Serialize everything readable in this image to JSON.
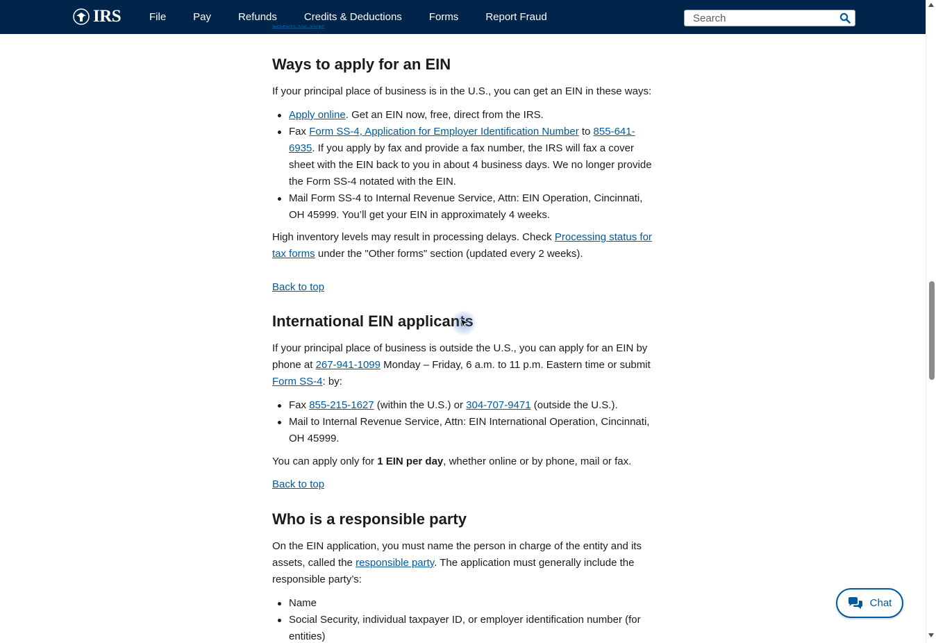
{
  "header": {
    "logo_text": "IRS",
    "nav": [
      "File",
      "Pay",
      "Refunds",
      "Credits & Deductions",
      "Forms",
      "Report Fraud"
    ],
    "search_placeholder": "Search"
  },
  "section_ways": {
    "heading": "Ways to apply for an EIN",
    "intro": "If your principal place of business is in the U.S., you can get an EIN in these ways:",
    "item1_link": "Apply online",
    "item1_text": ". Get an EIN now, free, direct from the IRS.",
    "item2_prefix": "Fax ",
    "item2_link_form": "Form SS-4, Application for Employer Identification Number",
    "item2_mid": " to ",
    "item2_link_phone": "855-641-6935",
    "item2_text": ". If you apply by fax and provide a fax number, the IRS will fax a cover sheet with the EIN back to you in about 4 business days. We no longer provide the Form SS-4 notated with the EIN.",
    "item3_text": "Mail Form SS-4 to Internal Revenue Service, Attn: EIN Operation, Cincinnati, OH 45999. You’ll get your EIN in approximately 4 weeks.",
    "delay_prefix": "High inventory levels may result in processing delays. Check ",
    "delay_link": "Processing status for tax forms",
    "delay_suffix": " under the \"Other forms\" section (updated every 2 weeks).",
    "back_to_top": "Back to top"
  },
  "section_international": {
    "heading": "International EIN applicants",
    "intro_prefix": "If your principal place of business is outside the U.S., you can apply for an EIN by phone at ",
    "phone_link": "267-941-1099",
    "intro_mid": " Monday – Friday, 6 a.m. to 11 p.m. Eastern time or submit ",
    "form_link": "Form SS-4",
    "intro_suffix": ": by:",
    "fax_prefix": "Fax ",
    "fax_link1": "855-215-1627",
    "fax_mid": " (within the U.S.) or ",
    "fax_link2": "304-707-9471",
    "fax_suffix": " (outside the U.S.).",
    "mail_text": "Mail to Internal Revenue Service, Attn: EIN International Operation, Cincinnati, OH 45999.",
    "limit_prefix": "You can apply only for ",
    "limit_bold": "1 EIN per day",
    "limit_suffix": ", whether online or by phone, mail or fax.",
    "back_to_top": "Back to top"
  },
  "section_responsible": {
    "heading": "Who is a responsible party",
    "intro_prefix": "On the EIN application, you must name the person in charge of the entity and its assets, called the ",
    "party_link": "responsible party",
    "intro_suffix": ". The application must generally include the responsible party’s:",
    "items": [
      "Name",
      "Social Security, individual taxpayer ID, or employer identification number (for entities)"
    ]
  },
  "chat": {
    "label": "Chat"
  }
}
